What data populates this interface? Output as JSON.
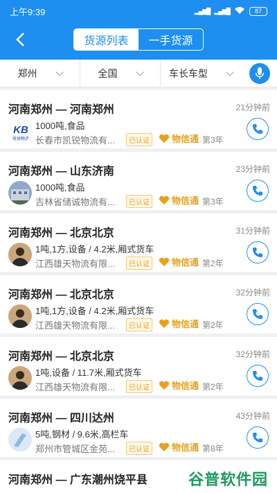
{
  "status": {
    "time": "上午9:39",
    "battery": "87"
  },
  "header": {
    "tabs": [
      {
        "label": "货源列表",
        "active": true
      },
      {
        "label": "一手货源",
        "active": false
      }
    ]
  },
  "filters": [
    "郑州",
    "全国",
    "车长车型"
  ],
  "items": [
    {
      "route": "河南郑州 — 河南郑州",
      "time": "21分钟前",
      "desc": "1000吨,食品",
      "company": "长春市凯锐物流有...",
      "badge": "已认证",
      "wx": "物信通",
      "years": "第3年"
    },
    {
      "route": "河南郑州 — 山东济南",
      "time": "23分钟前",
      "desc": "1000吨,食品",
      "company": "吉林省储诚物流有...",
      "badge": "已认证",
      "wx": "物信通",
      "years": "第3年"
    },
    {
      "route": "河南郑州 — 北京北京",
      "time": "31分钟前",
      "desc": "1吨,1方,设备 / 4.2米,厢式货车",
      "company": "江西雄天物流有限...",
      "badge": "已认证",
      "wx": "物信通",
      "years": "第2年"
    },
    {
      "route": "河南郑州 — 北京北京",
      "time": "32分钟前",
      "desc": "1吨,1方,设备 / 4.2米,厢式货车",
      "company": "江西雄天物流有限...",
      "badge": "已认证",
      "wx": "物信通",
      "years": "第2年"
    },
    {
      "route": "河南郑州 — 北京北京",
      "time": "32分钟前",
      "desc": "1吨,设备 / 11.7米,厢式货车",
      "company": "江西雄天物流有限...",
      "badge": "已认证",
      "wx": "物信通",
      "years": "第2年"
    },
    {
      "route": "河南郑州 — 四川达州",
      "time": "43分钟前",
      "desc": "5吨,钢材 / 9.6米,高栏车",
      "company": "郑州市管城区金苑...",
      "badge": "已认证",
      "wx": "物信通",
      "years": "第8年"
    },
    {
      "route": "河南郑州 — 广东潮州饶平县",
      "time": "",
      "desc": "",
      "company": "",
      "badge": "",
      "wx": "",
      "years": ""
    }
  ],
  "avatar1": {
    "text": "KB",
    "caption": "凯锐物流"
  },
  "watermark": "谷普软件园",
  "colors": {
    "primary": "#1e8ef0",
    "gold": "#e6a11f",
    "watermark": "#1a9b5e"
  }
}
